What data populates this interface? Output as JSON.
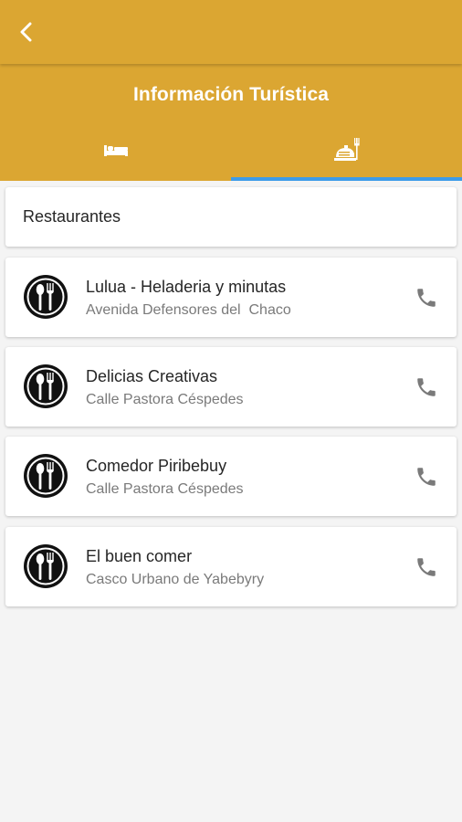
{
  "header": {
    "title": "Información Turística",
    "background_color": "#dba632",
    "indicator_color": "#3d9be9"
  },
  "tabs": [
    {
      "icon": "bed-icon",
      "selected": false
    },
    {
      "icon": "restaurant-icon",
      "selected": true
    }
  ],
  "section": {
    "label": "Restaurantes"
  },
  "items": [
    {
      "name": "Lulua - Heladeria y minutas",
      "address": "Avenida Defensores del  Chaco",
      "icon": "cutlery-icon",
      "action_icon": "phone-icon"
    },
    {
      "name": "Delicias Creativas",
      "address": "Calle Pastora Céspedes",
      "icon": "cutlery-icon",
      "action_icon": "phone-icon"
    },
    {
      "name": "Comedor Piribebuy",
      "address": "Calle Pastora Céspedes",
      "icon": "cutlery-icon",
      "action_icon": "phone-icon"
    },
    {
      "name": "El buen comer",
      "address": "Casco Urbano de Yabebyry",
      "icon": "cutlery-icon",
      "action_icon": "phone-icon"
    }
  ]
}
